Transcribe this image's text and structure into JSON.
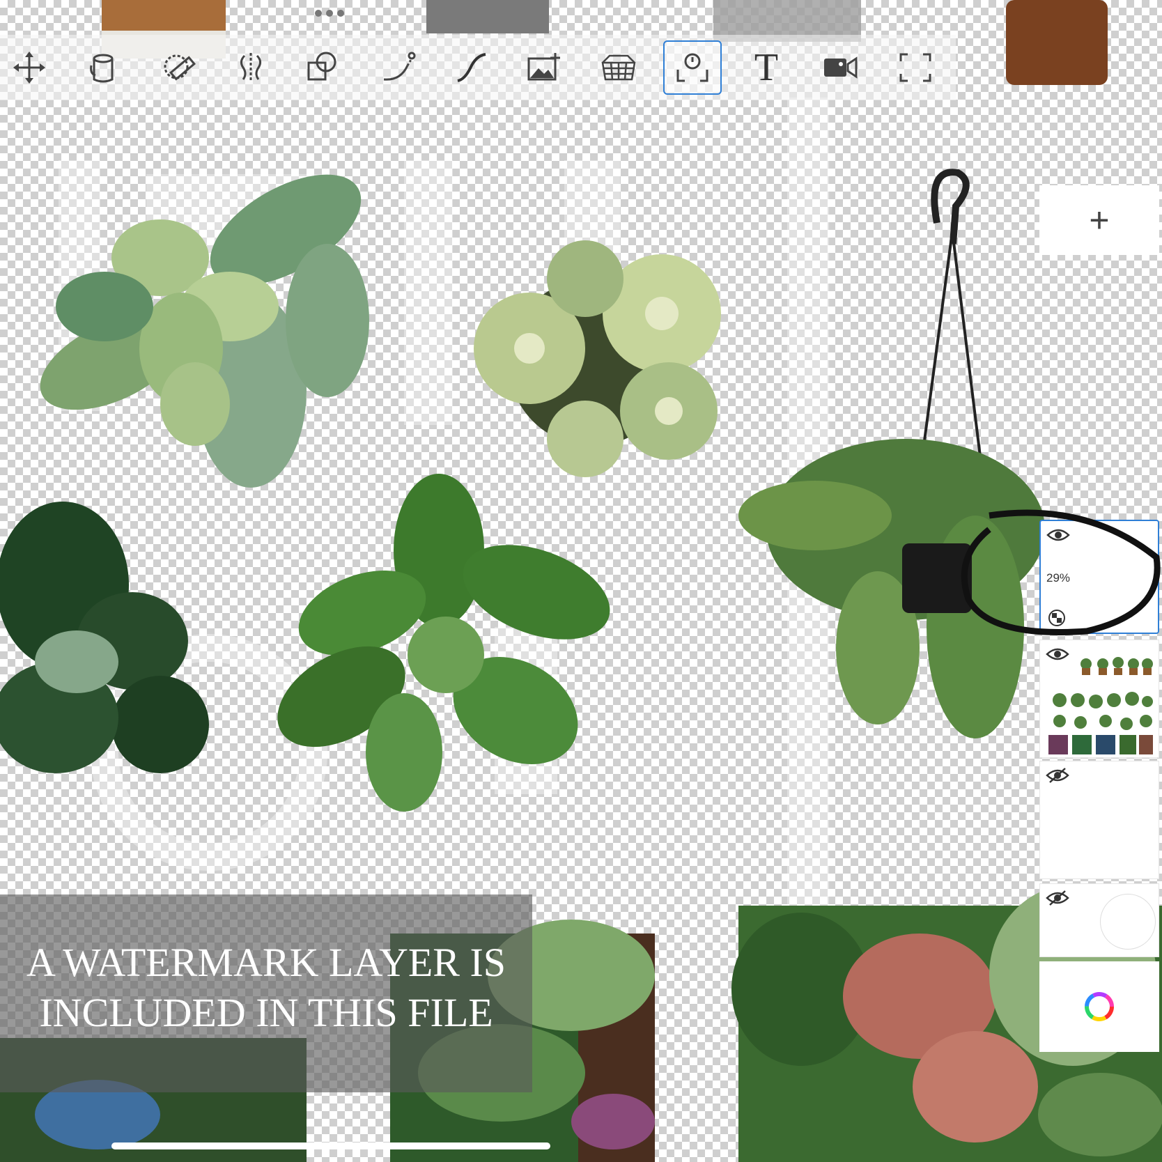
{
  "app": {
    "toolbar": {
      "tools": [
        {
          "name": "move-tool",
          "icon": "arrows-move-icon",
          "active": false
        },
        {
          "name": "fill-tool",
          "icon": "paint-bucket-icon",
          "active": false
        },
        {
          "name": "ruler-tool",
          "icon": "ruler-selection-icon",
          "active": false
        },
        {
          "name": "symmetry-tool",
          "icon": "symmetry-icon",
          "active": false
        },
        {
          "name": "shapes-tool",
          "icon": "shapes-icon",
          "active": false
        },
        {
          "name": "curve-tool",
          "icon": "bezier-curve-icon",
          "active": false
        },
        {
          "name": "stroke-tool",
          "icon": "stroke-icon",
          "active": false
        },
        {
          "name": "import-image-tool",
          "icon": "add-image-icon",
          "active": false
        },
        {
          "name": "perspective-tool",
          "icon": "perspective-grid-icon",
          "active": false
        },
        {
          "name": "time-lapse-tool",
          "icon": "time-lapse-icon",
          "active": true
        },
        {
          "name": "text-tool",
          "icon": "text-icon",
          "label": "T",
          "active": false
        },
        {
          "name": "record-tool",
          "icon": "video-camera-icon",
          "active": false
        },
        {
          "name": "fullscreen-tool",
          "icon": "fullscreen-icon",
          "active": false
        }
      ]
    },
    "layers_panel": {
      "add_label": "+",
      "layers": [
        {
          "visible": true,
          "opacity": "29%",
          "selected": true
        },
        {
          "visible": true,
          "thumbnail": "plants-collage-thumbnail",
          "selected": false
        },
        {
          "visible": false,
          "selected": false
        },
        {
          "visible": false,
          "selected": false
        }
      ],
      "color_picker_icon": "color-wheel-icon"
    },
    "banner": {
      "line1": "A WATERMARK LAYER IS",
      "line2": "INCLUDED IN THIS FILE"
    },
    "colors": {
      "accent": "#2f7fd6",
      "leaf_dark": "#2e5a2a",
      "leaf_mid": "#4f7f3c",
      "leaf_light": "#9fc08a",
      "succulent": "#b8c98e"
    }
  }
}
